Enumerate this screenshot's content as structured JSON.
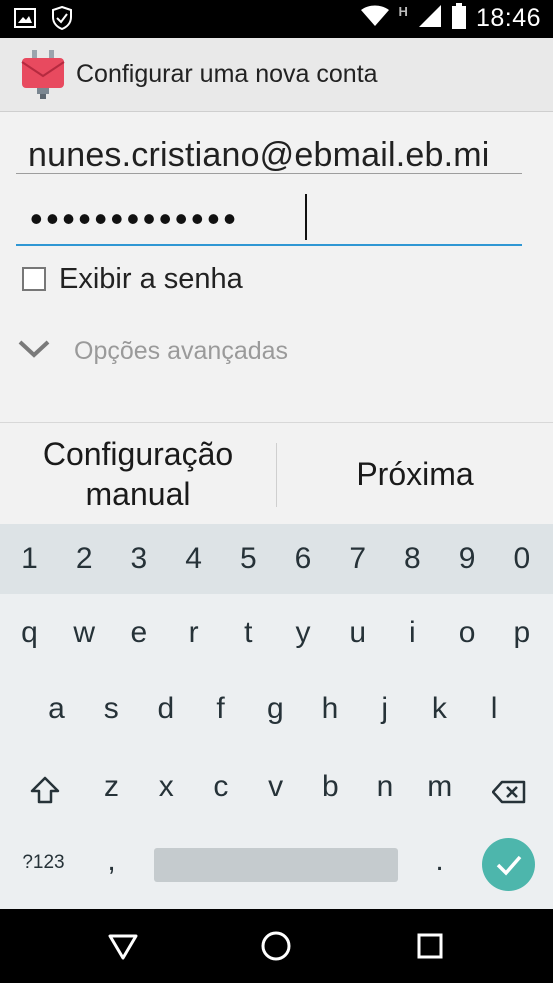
{
  "status_bar": {
    "time": "18:46",
    "network_label": "H",
    "icons": [
      "image-notification-icon",
      "shield-check-icon",
      "wifi-icon",
      "signal-icon",
      "battery-icon"
    ]
  },
  "app_bar": {
    "title": "Configurar uma nova conta",
    "icon": "email-app-icon"
  },
  "form": {
    "email_value": "nunes.cristiano@ebmail.eb.mi",
    "password_mask": "•••••••••••••",
    "show_password_label": "Exibir a senha",
    "show_password_checked": false,
    "advanced_label": "Opções avançadas"
  },
  "buttons": {
    "manual_line1": "Configuração",
    "manual_line2": "manual",
    "next": "Próxima"
  },
  "keyboard": {
    "numbers": [
      "1",
      "2",
      "3",
      "4",
      "5",
      "6",
      "7",
      "8",
      "9",
      "0"
    ],
    "row1": [
      "q",
      "w",
      "e",
      "r",
      "t",
      "y",
      "u",
      "i",
      "o",
      "p"
    ],
    "row2": [
      "a",
      "s",
      "d",
      "f",
      "g",
      "h",
      "j",
      "k",
      "l"
    ],
    "row3": [
      "z",
      "x",
      "c",
      "v",
      "b",
      "n",
      "m"
    ],
    "symbols_key": "?123",
    "comma_key": ",",
    "period_key": "."
  },
  "colors": {
    "accent": "#2f97d4",
    "enter_key": "#4db6ac",
    "app_icon": "#e84a5f"
  }
}
